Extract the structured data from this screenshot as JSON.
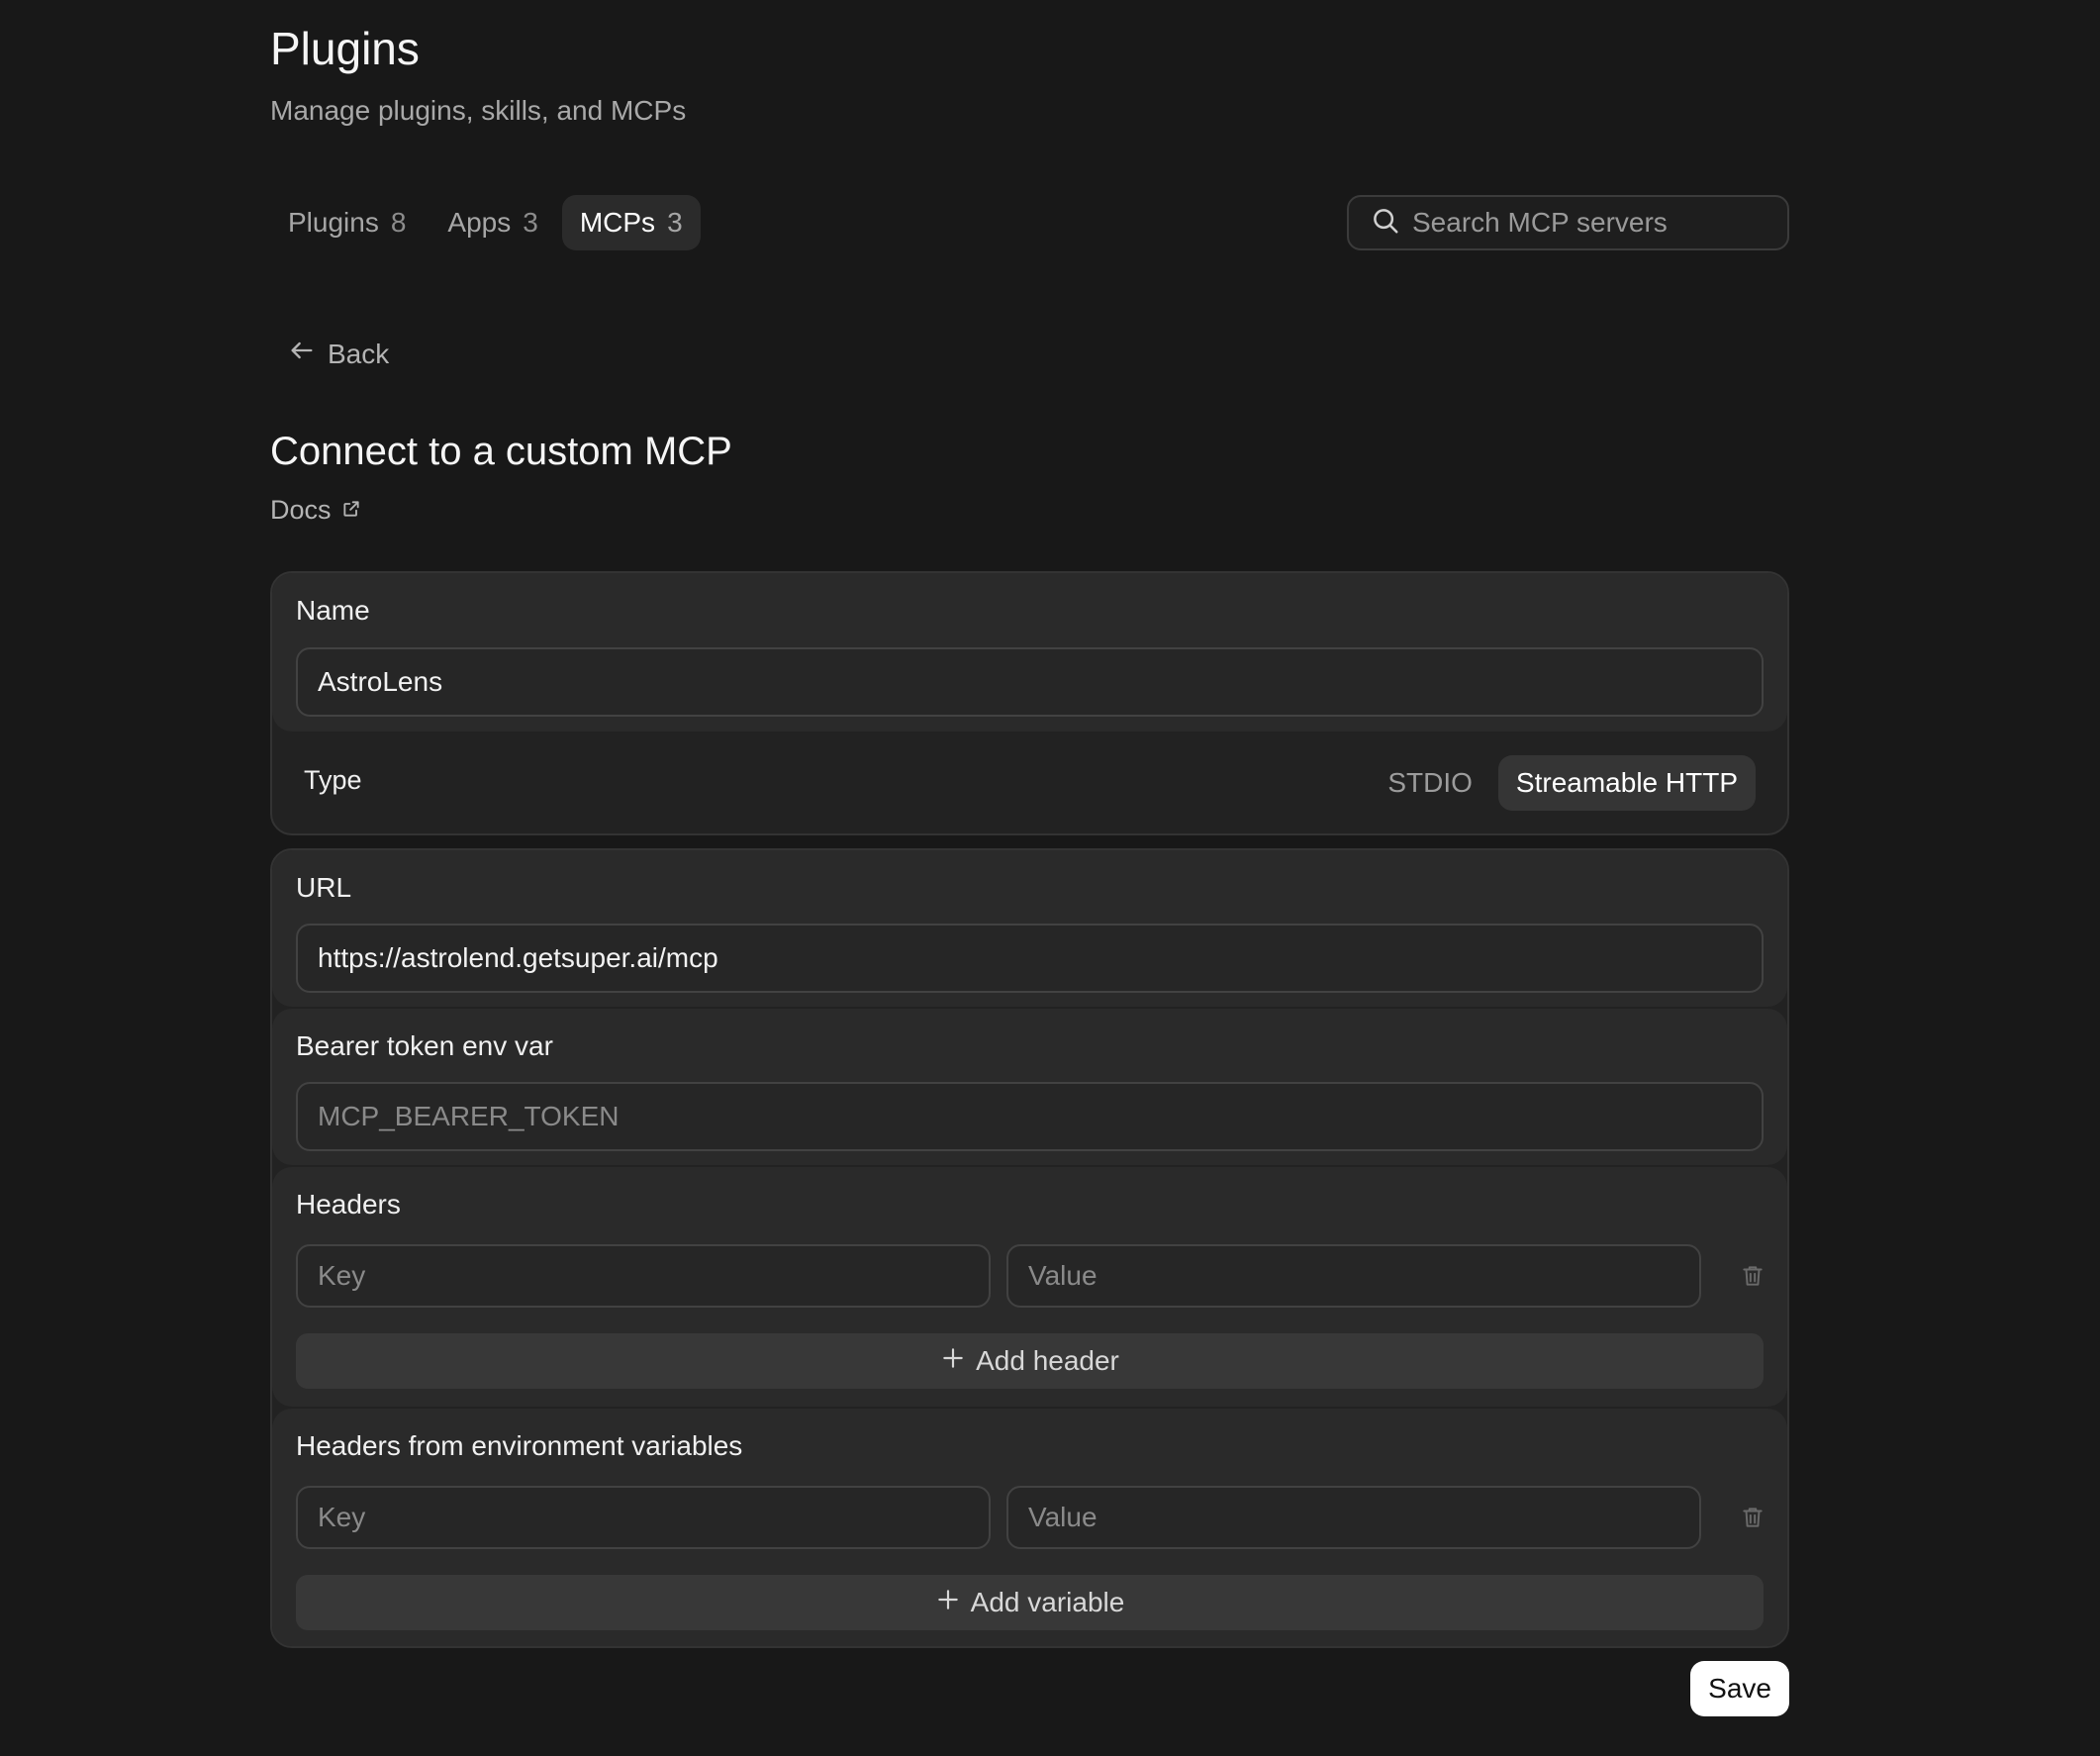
{
  "header": {
    "title": "Plugins",
    "subtitle": "Manage plugins, skills, and MCPs"
  },
  "tabs": [
    {
      "label": "Plugins",
      "count": "8",
      "active": false
    },
    {
      "label": "Apps",
      "count": "3",
      "active": false
    },
    {
      "label": "MCPs",
      "count": "3",
      "active": true
    }
  ],
  "search": {
    "placeholder": "Search MCP servers",
    "value": ""
  },
  "back": {
    "label": "Back"
  },
  "section": {
    "title": "Connect to a custom MCP",
    "docs_label": "Docs"
  },
  "form": {
    "name": {
      "label": "Name",
      "value": "AstroLens"
    },
    "type": {
      "label": "Type",
      "options": [
        "STDIO",
        "Streamable HTTP"
      ],
      "selected": "Streamable HTTP"
    },
    "url": {
      "label": "URL",
      "value": "https://astrolend.getsuper.ai/mcp"
    },
    "bearer": {
      "label": "Bearer token env var",
      "placeholder": "MCP_BEARER_TOKEN",
      "value": ""
    },
    "headers": {
      "label": "Headers",
      "key_placeholder": "Key",
      "value_placeholder": "Value",
      "add_label": "Add header"
    },
    "env_headers": {
      "label": "Headers from environment variables",
      "key_placeholder": "Key",
      "value_placeholder": "Value",
      "add_label": "Add variable"
    }
  },
  "save_label": "Save",
  "icons": {
    "search": "search-icon",
    "back": "arrow-left-icon",
    "docs": "external-link-icon",
    "trash": "trash-icon",
    "plus": "plus-icon"
  },
  "colors": {
    "background": "#181818",
    "card": "#222222",
    "subcard": "#2a2a2a",
    "accent_button": "#ffffff"
  }
}
